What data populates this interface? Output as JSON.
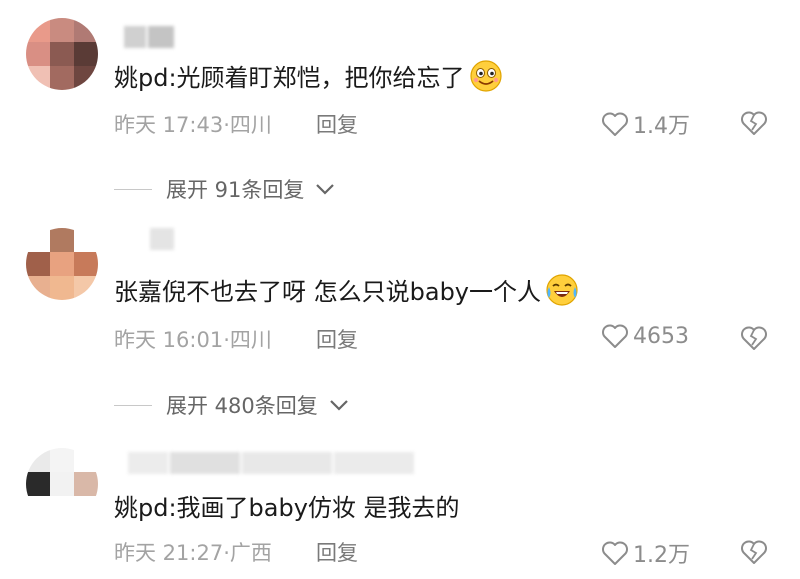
{
  "comments": [
    {
      "text": "姚pd:光顾着盯郑恺，把你给忘了",
      "emoji": "giggle-emoji",
      "time_location": "昨天 17:43·四川",
      "reply_label": "回复",
      "like_count": "1.4万",
      "expand_label": "展开 91条回复"
    },
    {
      "text": "张嘉倪不也去了呀 怎么只说baby一个人",
      "emoji": "crying-laughing-emoji",
      "time_location": "昨天 16:01·四川",
      "reply_label": "回复",
      "like_count": "4653",
      "expand_label": "展开 480条回复"
    },
    {
      "text": "姚pd:我画了baby仿妆 是我去的",
      "time_location": "昨天 21:27·广西",
      "reply_label": "回复",
      "like_count": "1.2万"
    }
  ],
  "colors": {
    "text": "#1a1a1a",
    "meta": "#a3a3a3",
    "icon": "#8c8c8c"
  }
}
